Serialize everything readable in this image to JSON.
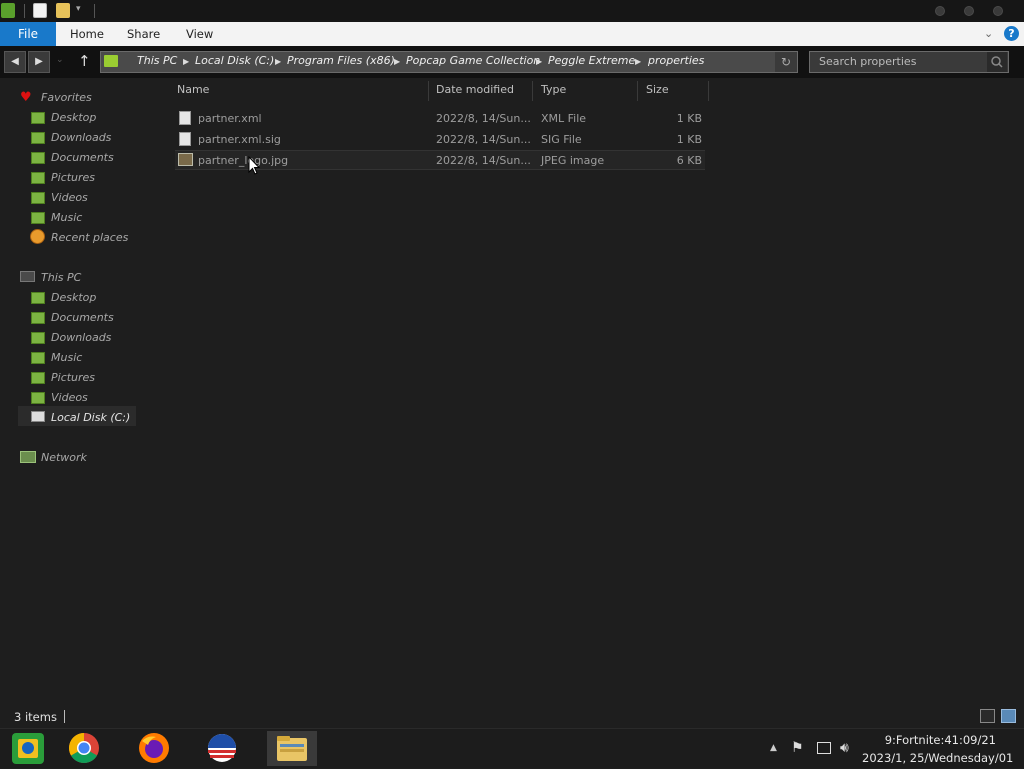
{
  "window": {
    "title_quick_access": [
      "properties-icon",
      "new-folder-icon",
      "folder-icon"
    ]
  },
  "ribbon": {
    "tabs": [
      "File",
      "Home",
      "Share",
      "View"
    ]
  },
  "address": {
    "breadcrumbs": [
      "This PC",
      "Local Disk (C:)",
      "Program Files (x86)",
      "Popcap Game Collection",
      "Peggle Extreme",
      "properties"
    ]
  },
  "search": {
    "placeholder": "Search properties"
  },
  "sidebar": {
    "favorites_label": "Favorites",
    "favorites": [
      "Desktop",
      "Downloads",
      "Documents",
      "Pictures",
      "Videos",
      "Music",
      "Recent places"
    ],
    "thispc_label": "This PC",
    "thispc": [
      "Desktop",
      "Documents",
      "Downloads",
      "Music",
      "Pictures",
      "Videos",
      "Local Disk (C:)"
    ],
    "network_label": "Network",
    "selected": "Local Disk (C:)"
  },
  "columns": {
    "name": "Name",
    "date": "Date modified",
    "type": "Type",
    "size": "Size"
  },
  "files": [
    {
      "name": "partner.xml",
      "date": "2022/8, 14/Sun...",
      "type": "XML File",
      "size": "1 KB"
    },
    {
      "name": "partner.xml.sig",
      "date": "2022/8, 14/Sun...",
      "type": "SIG File",
      "size": "1 KB"
    },
    {
      "name": "partner_logo.jpg",
      "date": "2022/8, 14/Sun...",
      "type": "JPEG image",
      "size": "6 KB"
    }
  ],
  "status": {
    "item_count": "3 items"
  },
  "taskbar": {
    "apps": [
      "media-app-icon",
      "chrome-icon",
      "firefox-icon",
      "outlook-like-icon",
      "file-explorer-icon"
    ],
    "clock_time": "9:Fortnite:41:09/21",
    "clock_date": "2023/1, 25/Wednesday/01"
  }
}
